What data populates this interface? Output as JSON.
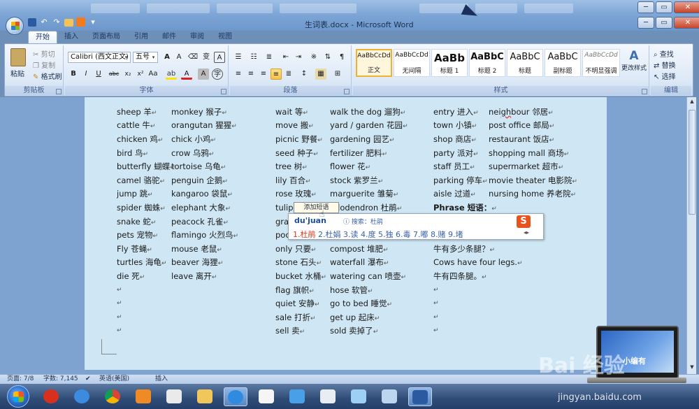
{
  "window": {
    "title": "生词表.docx - Microsoft Word",
    "controls": [
      "─",
      "▭",
      "✕"
    ]
  },
  "tabs": [
    "开始",
    "插入",
    "页面布局",
    "引用",
    "邮件",
    "审阅",
    "视图"
  ],
  "ribbon": {
    "clipboard": {
      "paste": "粘贴",
      "cut": "剪切",
      "copy": "复制",
      "format_painter": "格式刷",
      "label": "剪贴板"
    },
    "font": {
      "font_name": "Calibri (西文正文)",
      "font_size": "五号",
      "label": "字体"
    },
    "paragraph": {
      "label": "段落"
    },
    "styles": {
      "items": [
        {
          "sample": "AaBbCcDd",
          "name": "正文"
        },
        {
          "sample": "AaBbCcDd",
          "name": "无间隔"
        },
        {
          "sample": "AaBb",
          "name": "标题 1"
        },
        {
          "sample": "AaBbC",
          "name": "标题 2"
        },
        {
          "sample": "AaBbC",
          "name": "标题"
        },
        {
          "sample": "AaBbC",
          "name": "副标题"
        },
        {
          "sample": "AaBbCcDd",
          "name": "不明显强调"
        }
      ],
      "change_styles": "更改样式",
      "label": "样式"
    },
    "editing": {
      "find": "查找",
      "replace": "替换",
      "select": "选择",
      "label": "编辑"
    }
  },
  "document": {
    "col1": [
      "sheep 羊",
      "cattle 牛",
      "chicken 鸡",
      "bird 鸟",
      "butterfly 蝴蝶",
      "camel 骆驼",
      "jump 跳",
      "spider 蜘蛛",
      "snake 蛇",
      "pets 宠物",
      "Fly 苍蝇",
      "turtles 海龟",
      "die 死"
    ],
    "col2": [
      "monkey 猴子",
      "orangutan 猩猩",
      "chick 小鸡",
      "crow 乌鸦",
      "tortoise 乌龟",
      "penguin 企鹅",
      "kangaroo 袋鼠",
      "elephant 大象",
      "peacock 孔雀",
      "flamingo 火烈鸟",
      "mouse 老鼠",
      "beaver 海狸",
      "leave 离开"
    ],
    "col3": [
      "wait 等",
      "move 搬",
      "picnic 野餐",
      "seed 种子",
      "tree 树",
      "lily 百合",
      "rose 玫瑰",
      "tulip",
      "gra",
      "poc",
      "only 只要",
      "stone 石头",
      "bucket 水桶",
      "flag 旗帜",
      "quiet 安静",
      "sale 打折",
      "sell 卖"
    ],
    "col4": [
      "walk the dog 遛狗",
      "yard / garden 花园",
      "gardening 园艺",
      "fertilizer 肥料",
      "flower 花",
      "stock 紫罗兰",
      "marguerite 雏菊",
      "ododendron 杜鹃",
      "",
      "",
      "compost 堆肥",
      "waterfall 瀑布",
      "watering can 喷壶",
      "hose 软管",
      "go to bed 睡觉",
      "get up 起床",
      "sold 卖掉了"
    ],
    "col5": [
      "entry 进入",
      "town 小镇",
      "shop 商店",
      "party 派对",
      "staff 员工",
      "parking 停车",
      "aisle 过道",
      "Phrase 短语：",
      "",
      "",
      "牛有多少条腿？",
      "Cows have four legs.",
      "牛有四条腿。"
    ],
    "col6_prefix": "nei",
    "col6_highlight": "gh",
    "col6_rest": "bour 邻居",
    "col6": [
      "post office 邮局",
      "restaurant 饭店",
      "shopping mall 商场",
      "supermarket 超市",
      "movie theater 电影院",
      "nursing home 养老院"
    ]
  },
  "ime": {
    "pinyin": "du'juan",
    "search": "搜索：杜鹃",
    "candidates": [
      "1.杜鹃",
      "2.杜娟",
      "3.读",
      "4.度",
      "5.独",
      "6.毒",
      "7.嘟",
      "8.赌",
      "9.堵"
    ],
    "tooltip": "添加短语",
    "logo": "S"
  },
  "status": {
    "page": "页面: 7/8",
    "words": "字数: 7,145",
    "language": "英语(美国)",
    "mode": "插入"
  },
  "watermark": {
    "brand": "Bai 经验",
    "url": "jingyan.baidu.com",
    "laptop_text": "小编有"
  },
  "colors": {
    "page_bg": "#cfe7f4",
    "accent": "#2b5aa0",
    "ime_red": "#d4381b"
  }
}
